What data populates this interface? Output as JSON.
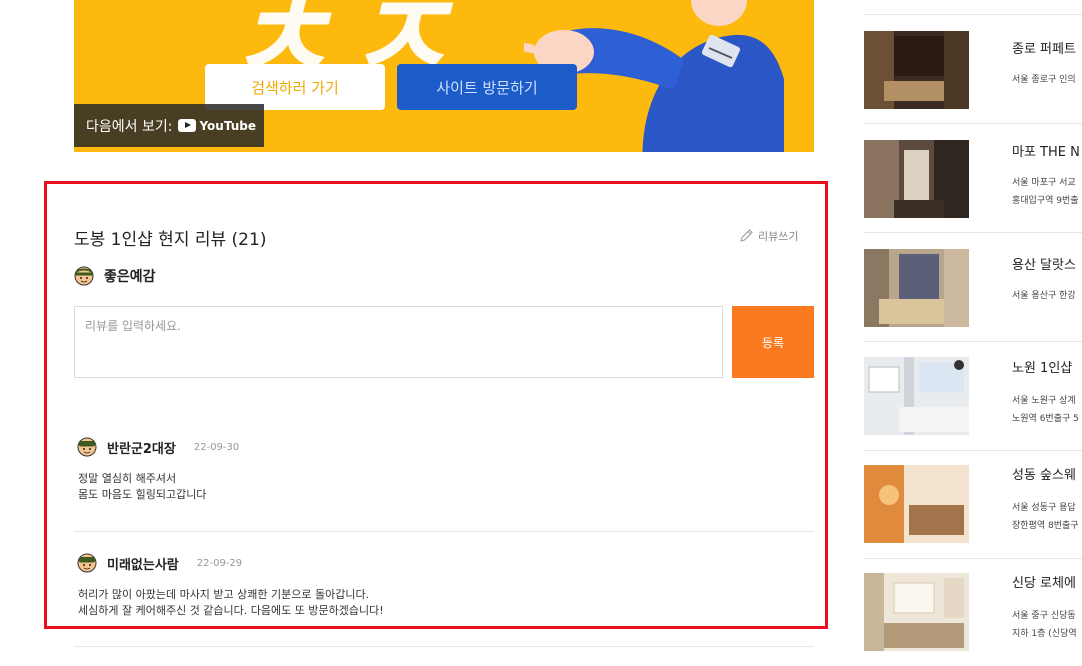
{
  "video": {
    "search_button": "검색하러 가기",
    "visit_button": "사이트 방문하기",
    "watch_on": "다음에서 보기:",
    "youtube": "YouTube"
  },
  "reviews": {
    "title": "도봉 1인샵 현지 리뷰 (21)",
    "write_link": "리뷰쓰기",
    "current_user": "좋은예감",
    "input_placeholder": "리뷰를 입력하세요.",
    "submit_label": "등록",
    "items": [
      {
        "author": "반란군2대장",
        "date": "22-09-30",
        "lines": [
          "정말 열심히 해주셔서",
          "몸도 마음도 힐링되고갑니다"
        ]
      },
      {
        "author": "미래없는사람",
        "date": "22-09-29",
        "lines": [
          "허리가 많이 아팠는데 마사지 받고 상쾌한 기분으로 돌아갑니다.",
          "세심하게 잘 케어해주신 것 같습니다. 다음에도 또 방문하겠습니다!"
        ]
      }
    ]
  },
  "sidebar": {
    "items": [
      {
        "title": "종로 퍼페트",
        "addr1": "서울 종로구 인의",
        "addr2": ""
      },
      {
        "title": "마포 THE N",
        "addr1": "서울 마포구 서교",
        "addr2": "홍대입구역 9번출"
      },
      {
        "title": "용산 달랏스",
        "addr1": "서울 용산구 한강",
        "addr2": ""
      },
      {
        "title": "노원 1인샵",
        "addr1": "서울 노원구 상계",
        "addr2": "노원역 6번출구 5"
      },
      {
        "title": "성동 숲스웨",
        "addr1": "서울 성동구 용답",
        "addr2": "장한평역 8번출구"
      },
      {
        "title": "신당 로체에",
        "addr1": "서울 중구 신당동",
        "addr2": "지하 1층 (신당역"
      }
    ]
  },
  "colors": {
    "accent_orange": "#fb7a1f",
    "banner_yellow": "#fdb90d",
    "highlight_red": "#e8101c"
  }
}
